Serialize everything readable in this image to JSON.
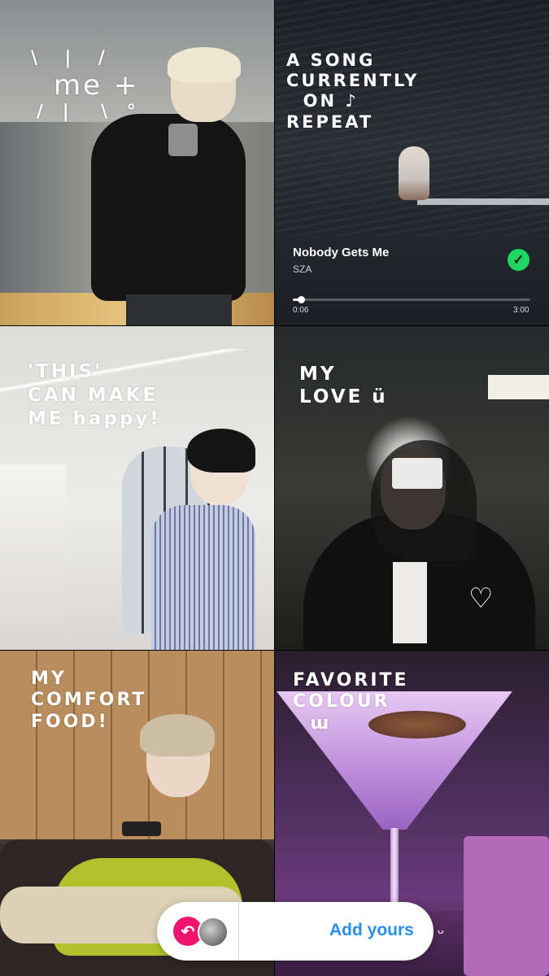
{
  "tiles": {
    "me": {
      "caption": "me +"
    },
    "song": {
      "caption": "A SONG\nCURRENTLY\n  ON ♪\nREPEAT",
      "track": "Nobody Gets Me",
      "artist": "SZA",
      "time_elapsed": "0:06",
      "time_total": "3:00",
      "progress": 0.033,
      "saved_icon": "check-icon"
    },
    "happy": {
      "caption": "'THIS'\nCAN MAKE\nME happy!"
    },
    "love": {
      "caption": "MY\nLOVE ü"
    },
    "comfort": {
      "caption": "MY\nCOMFORT\nFOOD!"
    },
    "colour": {
      "caption": "FAVORITE\nCOLOUR\n  ɯ"
    }
  },
  "add_yours": {
    "label": "Add yours",
    "reply_icon": "reply-arrow-icon"
  },
  "colors": {
    "accent_blue": "#2a8de8",
    "reply_pink": "#f0156f",
    "spotify_green": "#1ed760"
  }
}
